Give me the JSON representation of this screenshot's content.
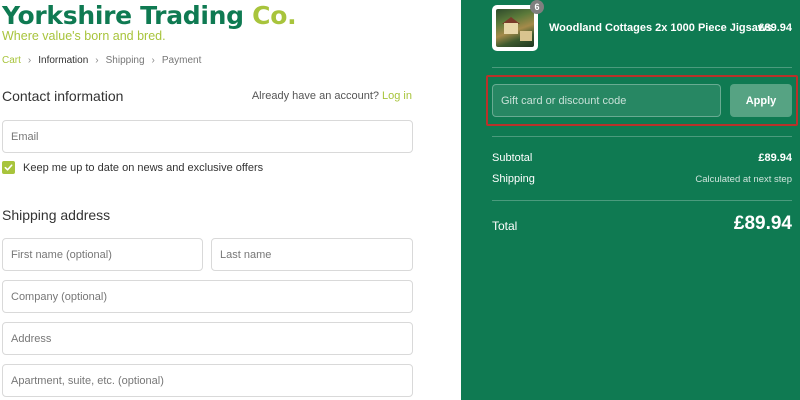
{
  "brand": {
    "name_main": "Yorkshire Trading",
    "name_suffix": "Co.",
    "tagline": "Where value's born and bred.",
    "primary_color": "#0f7a52",
    "accent_color": "#a8c43c"
  },
  "breadcrumb": {
    "items": [
      "Cart",
      "Information",
      "Shipping",
      "Payment"
    ],
    "active": "Information"
  },
  "contact": {
    "title": "Contact information",
    "account_prompt": "Already have an account?",
    "login_label": "Log in",
    "email_placeholder": "Email",
    "newsletter_label": "Keep me up to date on news and exclusive offers",
    "newsletter_checked": true
  },
  "shipping": {
    "title": "Shipping address",
    "first_name_placeholder": "First name (optional)",
    "last_name_placeholder": "Last name",
    "company_placeholder": "Company (optional)",
    "address_placeholder": "Address",
    "apartment_placeholder": "Apartment, suite, etc. (optional)"
  },
  "order": {
    "product": {
      "name": "Woodland Cottages 2x 1000 Piece Jigsaws",
      "quantity": "6",
      "price": "£89.94",
      "thumbnail_icon": "jigsaw-box-image"
    },
    "discount": {
      "placeholder": "Gift card or discount code",
      "apply_label": "Apply",
      "highlight_color": "#b8322a"
    },
    "subtotal_label": "Subtotal",
    "subtotal_value": "£89.94",
    "shipping_label": "Shipping",
    "shipping_value": "Calculated at next step",
    "total_label": "Total",
    "total_value": "£89.94"
  }
}
